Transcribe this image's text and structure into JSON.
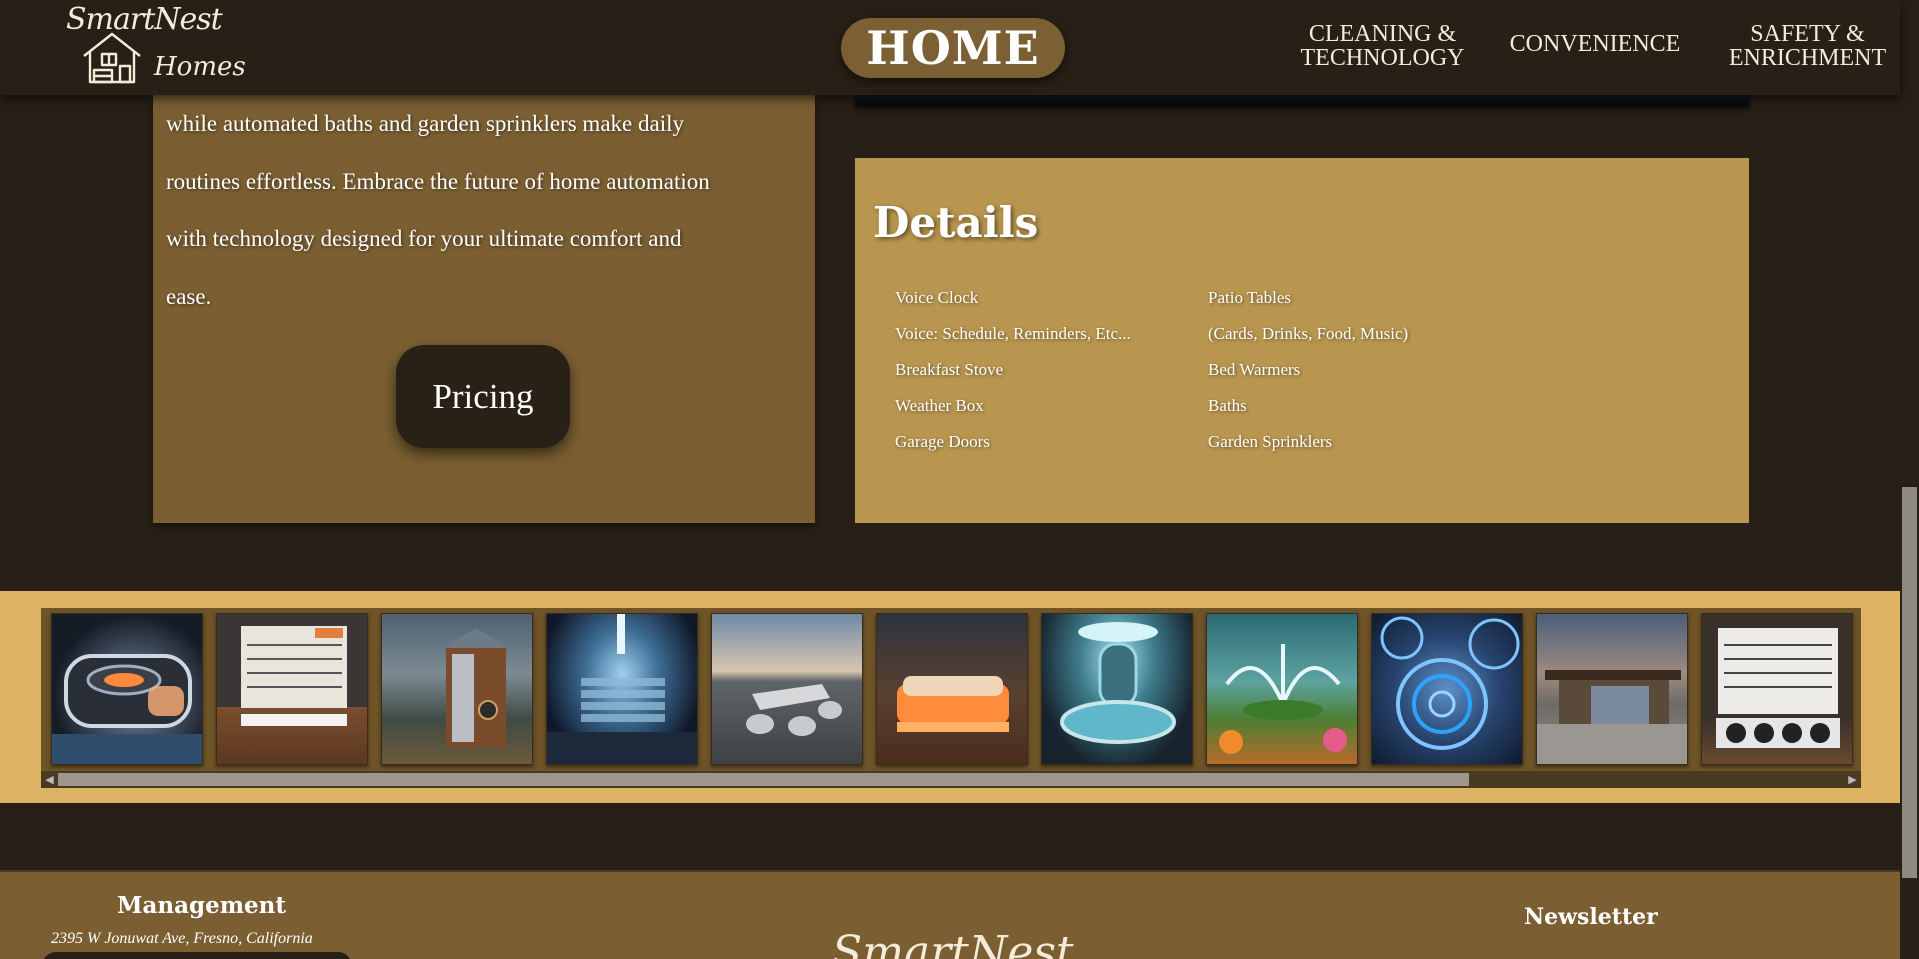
{
  "header": {
    "logo_line1": "SmartNest",
    "logo_line2": "Homes",
    "home_label": "HOME",
    "nav": {
      "cleaning": [
        "CLEANING &",
        "TECHNOLOGY"
      ],
      "convenience": "CONVENIENCE",
      "safety": [
        "SAFETY &",
        "ENRICHMENT"
      ]
    }
  },
  "intro": {
    "lines": [
      "while automated baths and garden sprinklers make daily",
      "routines effortless. Embrace the future of home automation",
      "with technology designed for your ultimate comfort and",
      "ease."
    ],
    "pricing_label": "Pricing"
  },
  "details": {
    "title": "Details",
    "column_a": [
      "Voice Clock",
      "Voice: Schedule, Reminders, Etc...",
      "Breakfast Stove",
      "Weather Box",
      "Garage Doors"
    ],
    "column_b": [
      "Patio Tables",
      "(Cards, Drinks, Food, Music)",
      "Bed Warmers",
      "Baths",
      "Garden Sprinklers"
    ]
  },
  "gallery": {
    "thumbnails": [
      {
        "name": "breakfast-stove-image"
      },
      {
        "name": "calendar-image"
      },
      {
        "name": "weather-box-image"
      },
      {
        "name": "garage-door-interior-image"
      },
      {
        "name": "patio-tables-image"
      },
      {
        "name": "bed-warmer-image"
      },
      {
        "name": "bath-image"
      },
      {
        "name": "garden-sprinkler-image"
      },
      {
        "name": "stove-burners-image"
      },
      {
        "name": "garage-exterior-image"
      },
      {
        "name": "voice-calendar-image"
      }
    ],
    "scroll_fraction": 0.79
  },
  "footer": {
    "management_title": "Management",
    "address": "2395 W Jonuwat Ave, Fresno, California",
    "logo_text": "SmartNest",
    "newsletter_title": "Newsletter"
  }
}
